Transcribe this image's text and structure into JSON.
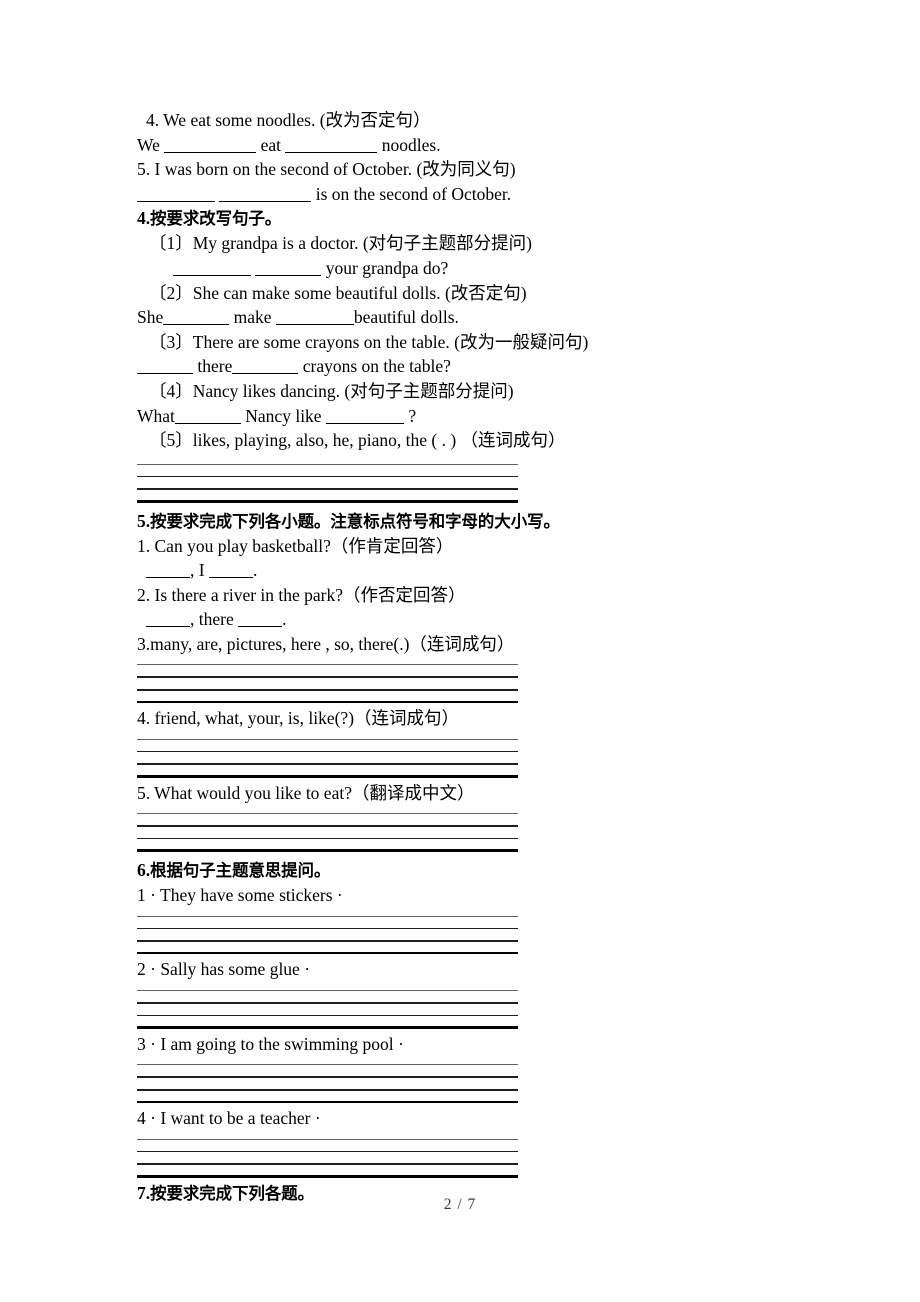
{
  "page": {
    "footer": "2 / 7"
  },
  "top_items": {
    "q4": {
      "prompt": "4. We eat some noodles. (改为否定句）",
      "answer_prefix": "We",
      "answer_mid": "eat",
      "answer_suffix": "noodles."
    },
    "q5": {
      "prompt": "5. I was born on the second of October. (改为同义句)",
      "answer_suffix": "is on the second of October."
    }
  },
  "section4": {
    "number": "4.",
    "heading": "按要求改写句子。",
    "items": [
      {
        "label": "〔1〕",
        "prompt": "My grandpa is a doctor. (对句子主题部分提问)",
        "answer_suffix": "your grandpa do?"
      },
      {
        "label": "〔2〕",
        "prompt": "She can make some beautiful dolls. (改否定句)",
        "answer_prefix": "She",
        "answer_mid": "make",
        "answer_suffix": "beautiful dolls."
      },
      {
        "label": "〔3〕",
        "prompt": "There are some crayons on the table. (改为一般疑问句)",
        "answer_mid": "there",
        "answer_suffix": "crayons on the table?"
      },
      {
        "label": "〔4〕",
        "prompt": "Nancy likes dancing. (对句子主题部分提问)",
        "answer_prefix": "What",
        "answer_mid": "Nancy like",
        "answer_suffix": "?"
      },
      {
        "label": "〔5〕",
        "prompt": "likes, playing, also, he, piano, the ( . ) （连词成句）"
      }
    ]
  },
  "section5": {
    "number": "5.",
    "heading": "按要求完成下列各小题。注意标点符号和字母的大小写。",
    "items": [
      {
        "prompt": "1. Can you play basketball?（作肯定回答）",
        "answer_joiner": ", I",
        "answer_end": "."
      },
      {
        "prompt": "2. Is there a river in the park?（作否定回答）",
        "answer_joiner": ", there",
        "answer_end": "."
      },
      {
        "prompt": "3.many, are, pictures, here , so, there(.)（连词成句）"
      },
      {
        "prompt": "4. friend, what, your, is, like(?)（连词成句）"
      },
      {
        "prompt": "5. What would you like to eat?（翻译成中文）"
      }
    ]
  },
  "section6": {
    "number": "6.",
    "heading": "根据句子主题意思提问。",
    "items": [
      {
        "prompt": "1 · They have some stickers ·"
      },
      {
        "prompt": "2 · Sally has some glue ·"
      },
      {
        "prompt": "3 · I am going to the swimming pool ·"
      },
      {
        "prompt": "4 · I want to be a teacher ·"
      }
    ]
  },
  "section7": {
    "number": "7.",
    "heading": "按要求完成下列各题。"
  }
}
